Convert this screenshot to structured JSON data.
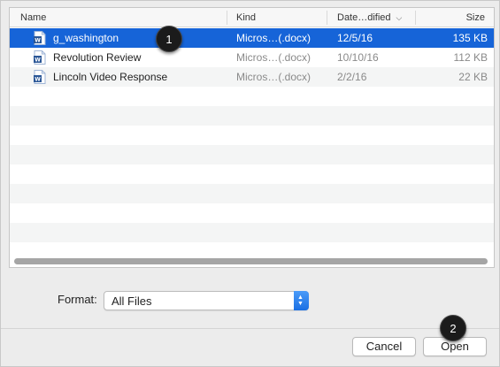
{
  "columns": {
    "name": "Name",
    "kind": "Kind",
    "date_modified": "Date…dified",
    "size": "Size"
  },
  "sort_icon": "chevron-down-icon",
  "files": [
    {
      "name": "g_washington",
      "kind": "Micros…(.docx)",
      "date": "12/5/16",
      "size": "135 KB",
      "selected": true,
      "icon": "word-document-icon"
    },
    {
      "name": "Revolution Review",
      "kind": "Micros…(.docx)",
      "date": "10/10/16",
      "size": "112 KB",
      "selected": false,
      "icon": "word-document-icon"
    },
    {
      "name": "Lincoln Video Response",
      "kind": "Micros…(.docx)",
      "date": "2/2/16",
      "size": "22 KB",
      "selected": false,
      "icon": "word-document-icon"
    }
  ],
  "format": {
    "label": "Format:",
    "value": "All Files"
  },
  "buttons": {
    "cancel": "Cancel",
    "open": "Open"
  },
  "callouts": [
    "1",
    "2"
  ],
  "colors": {
    "selection": "#1664d8",
    "callout": "#1b1b1b",
    "select_accent": "#1a6fe3"
  }
}
